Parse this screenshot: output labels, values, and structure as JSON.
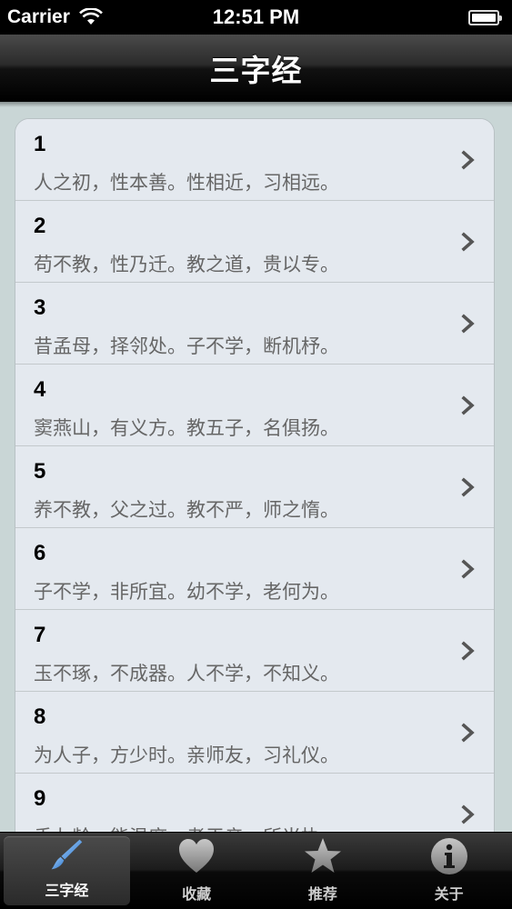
{
  "status_bar": {
    "carrier": "Carrier",
    "time": "12:51 PM",
    "battery_level": 1.0
  },
  "nav": {
    "title": "三字经"
  },
  "list": [
    {
      "number": "1",
      "text": "人之初，性本善。性相近，习相远。"
    },
    {
      "number": "2",
      "text": "苟不教，性乃迁。教之道，贵以专。"
    },
    {
      "number": "3",
      "text": "昔孟母，择邻处。子不学，断机杼。"
    },
    {
      "number": "4",
      "text": "窦燕山，有义方。教五子，名俱扬。"
    },
    {
      "number": "5",
      "text": "养不教，父之过。教不严，师之惰。"
    },
    {
      "number": "6",
      "text": "子不学，非所宜。幼不学，老何为。"
    },
    {
      "number": "7",
      "text": "玉不琢，不成器。人不学，不知义。"
    },
    {
      "number": "8",
      "text": "为人子，方少时。亲师友，习礼仪。"
    },
    {
      "number": "9",
      "text": "香九龄，能温席。孝于亲，所当执。"
    }
  ],
  "tabs": [
    {
      "label": "三字经",
      "icon": "brush-icon",
      "selected": true
    },
    {
      "label": "收藏",
      "icon": "heart-icon",
      "selected": false
    },
    {
      "label": "推荐",
      "icon": "star-icon",
      "selected": false
    },
    {
      "label": "关于",
      "icon": "info-icon",
      "selected": false
    }
  ],
  "colors": {
    "accent_blue": "#4a8fd6",
    "tab_icon_gray": "#9a9a9a",
    "row_bg": "#e4e9ef",
    "content_bg": "#c9d6d6"
  }
}
